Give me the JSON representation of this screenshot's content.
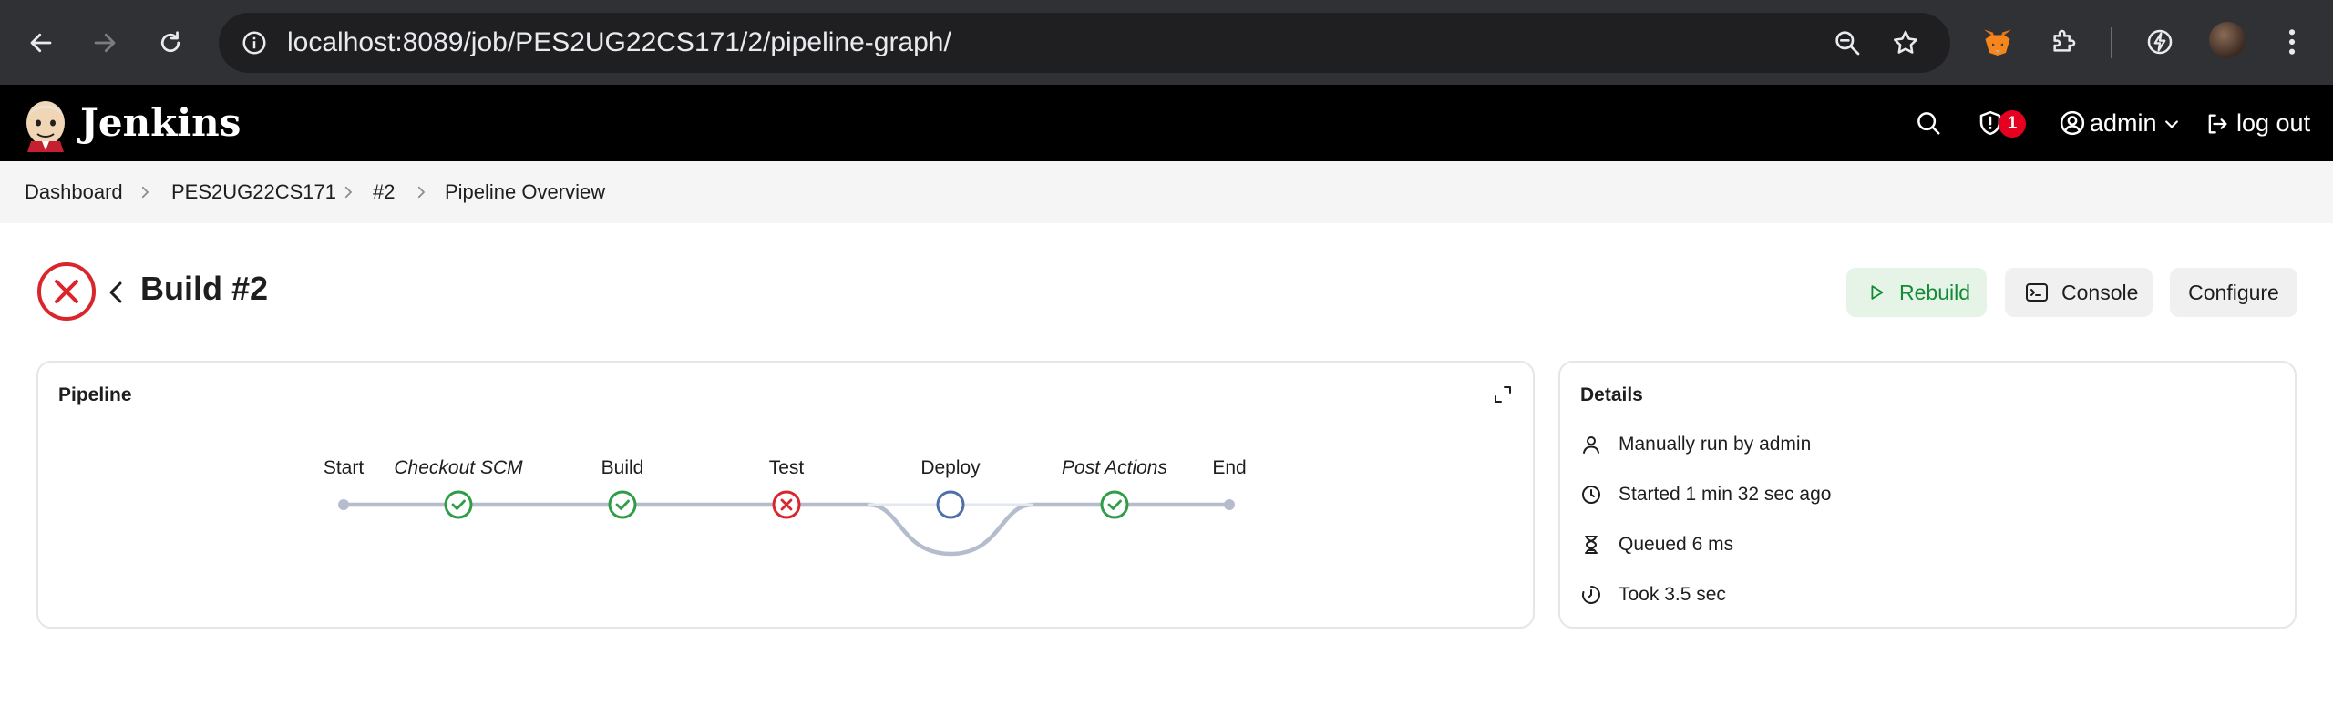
{
  "browser": {
    "url": "localhost:8089/job/PES2UG22CS171/2/pipeline-graph/",
    "icons": [
      "back-arrow-icon",
      "forward-arrow-icon",
      "reload-icon",
      "site-info-icon",
      "zoom-icon",
      "bookmark-star-icon",
      "metamask-fox-icon",
      "extensions-puzzle-icon",
      "performance-icon",
      "profile-avatar",
      "kebab-menu-icon"
    ]
  },
  "header": {
    "brand": "Jenkins",
    "security_count": "1",
    "user": "admin",
    "logout": "log out"
  },
  "breadcrumb": [
    "Dashboard",
    "PES2UG22CS171",
    "#2",
    "Pipeline Overview"
  ],
  "build": {
    "title": "Build #2",
    "status": "failed",
    "status_color": "#d9262c"
  },
  "actions": {
    "rebuild": "Rebuild",
    "console": "Console",
    "configure": "Configure"
  },
  "pipeline": {
    "title": "Pipeline",
    "stages": [
      {
        "label": "Start",
        "status": "start",
        "italic": false
      },
      {
        "label": "Checkout SCM",
        "status": "success",
        "italic": true
      },
      {
        "label": "Build",
        "status": "success",
        "italic": false
      },
      {
        "label": "Test",
        "status": "failure",
        "italic": false
      },
      {
        "label": "Deploy",
        "status": "not-built",
        "italic": false
      },
      {
        "label": "Post Actions",
        "status": "success",
        "italic": true
      },
      {
        "label": "End",
        "status": "end",
        "italic": false
      }
    ],
    "colors": {
      "success": "#2f9d47",
      "failure": "#d9262c",
      "not_built": "#4f6fa8",
      "line": "#b4bccd"
    }
  },
  "details": {
    "title": "Details",
    "rows": [
      {
        "icon": "user-icon",
        "text": "Manually run by admin"
      },
      {
        "icon": "clock-icon",
        "text": "Started 1 min 32 sec ago"
      },
      {
        "icon": "hourglass-icon",
        "text": "Queued 6 ms"
      },
      {
        "icon": "timer-icon",
        "text": "Took 3.5 sec"
      }
    ]
  }
}
